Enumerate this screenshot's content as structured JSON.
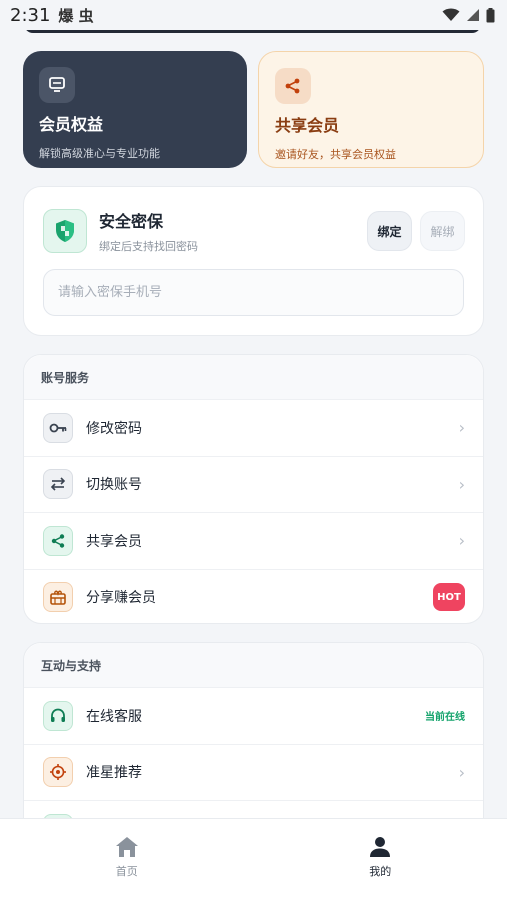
{
  "status_bar": {
    "time": "2:31",
    "left_glyphs": "爆 虫"
  },
  "promo": {
    "vip": {
      "title": "会员权益",
      "subtitle": "解锁高级准心与专业功能"
    },
    "share": {
      "title": "共享会员",
      "subtitle": "邀请好友，共享会员权益"
    }
  },
  "security": {
    "title": "安全密保",
    "subtitle": "绑定后支持找回密码",
    "bind_label": "绑定",
    "unbind_label": "解绑",
    "phone_placeholder": "请输入密保手机号"
  },
  "account_section": {
    "title": "账号服务",
    "items": [
      {
        "label": "修改密码",
        "icon": "key-icon"
      },
      {
        "label": "切换账号",
        "icon": "swap-icon"
      },
      {
        "label": "共享会员",
        "icon": "share-icon"
      },
      {
        "label": "分享赚会员",
        "icon": "gift-icon",
        "badge": "HOT"
      }
    ]
  },
  "support_section": {
    "title": "互动与支持",
    "items": [
      {
        "label": "在线客服",
        "icon": "headset-icon",
        "status": "当前在线"
      },
      {
        "label": "准星推荐",
        "icon": "crosshair-icon"
      }
    ]
  },
  "bottom_nav": {
    "home_label": "首页",
    "me_label": "我的"
  },
  "colors": {
    "dark_card": "#343e50",
    "share_accent": "#8a3d12",
    "green_accent": "#13a36b",
    "hot_badge": "#ef4460"
  }
}
